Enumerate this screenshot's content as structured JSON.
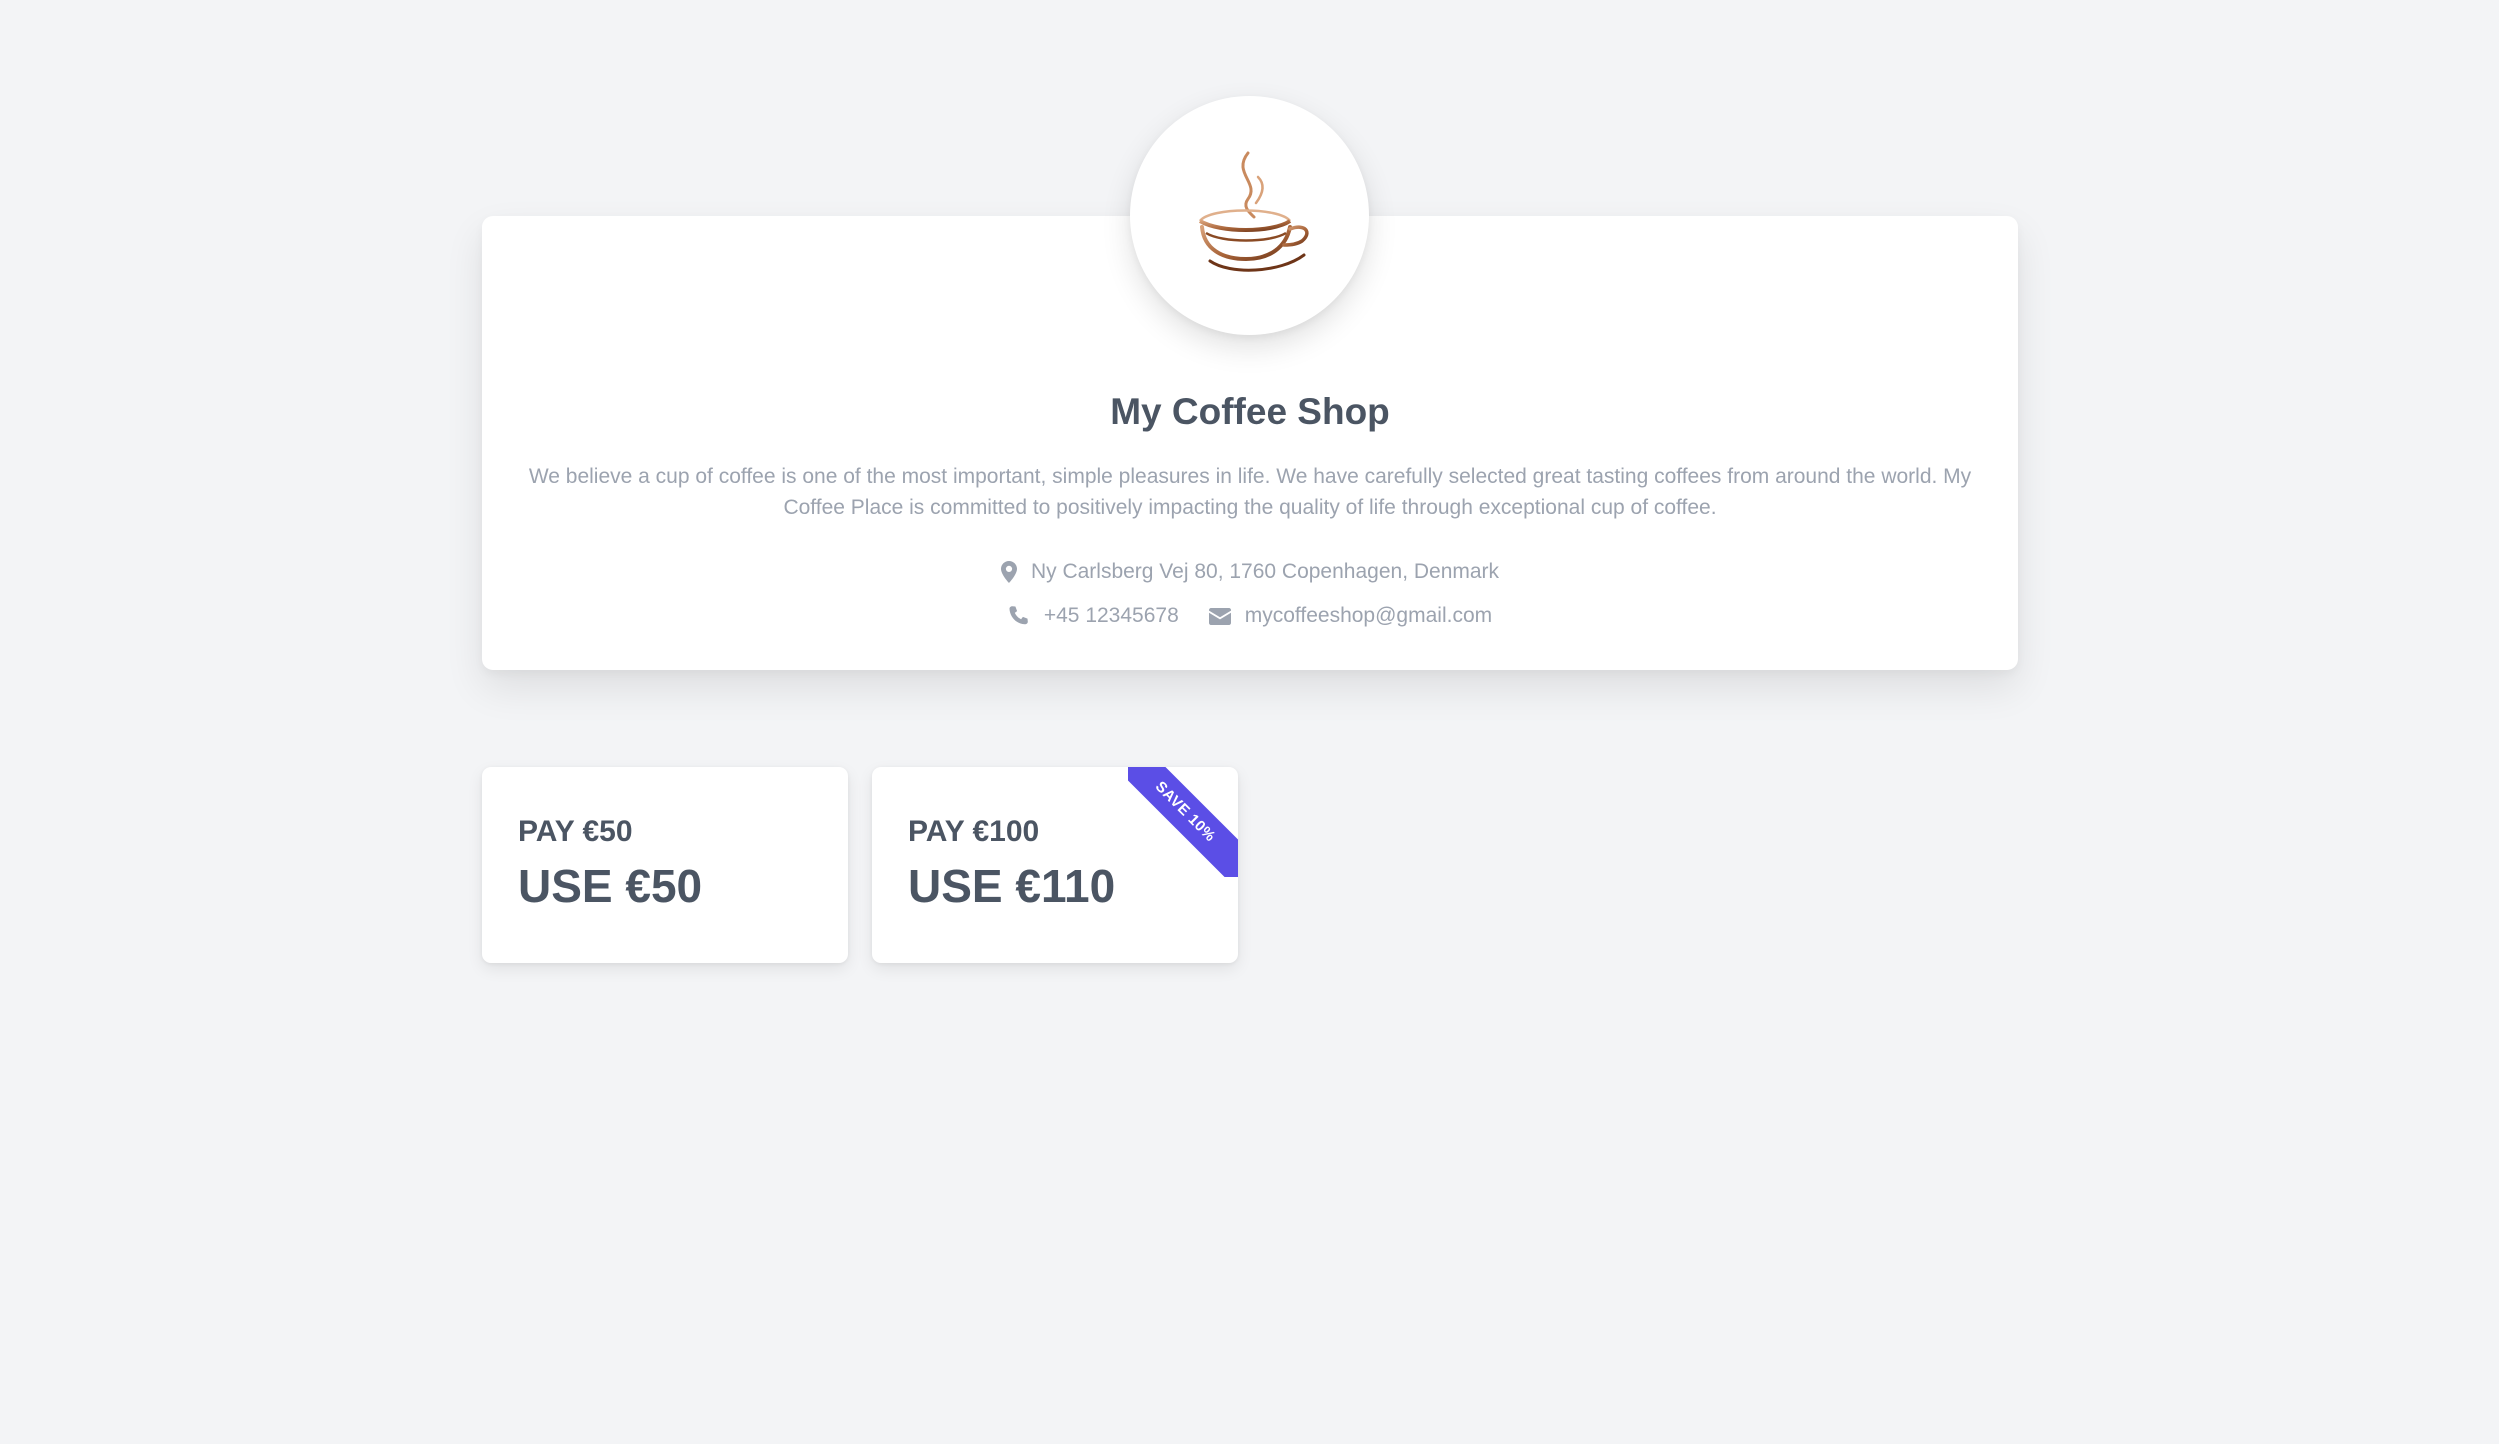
{
  "shop": {
    "logo_icon": "coffee-cup-logo",
    "name": "My Coffee Shop",
    "description": "We believe a cup of coffee is one of the most important, simple pleasures in life. We have carefully selected great tasting coffees from around the world. My Coffee Place is committed to positively impacting the quality of life through exceptional cup of coffee.",
    "address": "Ny Carlsberg Vej 80, 1760 Copenhagen, Denmark",
    "phone": "+45 12345678",
    "email": "mycoffeeshop@gmail.com"
  },
  "vouchers": [
    {
      "pay": "PAY €50",
      "use": "USE €50",
      "ribbon": ""
    },
    {
      "pay": "PAY €100",
      "use": "USE €110",
      "ribbon": "SAVE 10%"
    }
  ],
  "colors": {
    "background": "#f3f4f6",
    "card": "#ffffff",
    "title": "#4b5563",
    "muted": "#9ca3af",
    "ribbon": "#5b4ee6",
    "logo_brown": "#8a4a24"
  },
  "icons": {
    "address": "map-pin-icon",
    "phone": "phone-icon",
    "email": "envelope-icon"
  }
}
